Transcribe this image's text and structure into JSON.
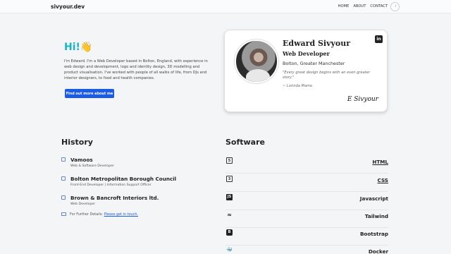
{
  "nav": {
    "brand": "sivyour.dev",
    "links": [
      "HOME",
      "ABOUT",
      "CONTACT"
    ],
    "theme_toggle": "☽"
  },
  "hero": {
    "title": "Hi!",
    "wave": "👋",
    "intro": "I'm Edward. I'm a Web Developer based in Bolton, England, with experience in web design and development, logo and identity design, 3D modelling and product visualisation. I've worked with people of all walks of life, from DJs and interior designers, to food and health companies.",
    "cta_label": "Find out more about me"
  },
  "card": {
    "name": "Edward Sivyour",
    "role": "Web Developer",
    "location": "Bolton, Greater Manchester",
    "quote": "\"Every great design begins with an even greater story.\"",
    "author": "~ Lorinda Mamo",
    "signature": "E Sivyour",
    "linkedin_icon": "in"
  },
  "history": {
    "heading": "History",
    "items": [
      {
        "title": "Vamoos",
        "subtitle": "Web & Software Developer"
      },
      {
        "title": "Bolton Metropolitan Borough Council",
        "subtitle": "Front-End Developer | Information Support Officer"
      },
      {
        "title": "Brown & Bancroft Interiors ltd.",
        "subtitle": "Web Developer"
      }
    ],
    "further_text": "For Further Details: ",
    "further_link": "Please get in touch."
  },
  "software": {
    "heading": "Software",
    "items": [
      {
        "label": "HTML",
        "icon": "5",
        "color": "#333"
      },
      {
        "label": "CSS",
        "icon": "3",
        "color": "#333"
      },
      {
        "label": "Javascript",
        "icon": "JS",
        "color": "#222"
      },
      {
        "label": "Tailwind",
        "icon": "≈",
        "color": "#222"
      },
      {
        "label": "Bootstrap",
        "icon": "B",
        "color": "#222"
      },
      {
        "label": "Docker",
        "icon": "🐳",
        "color": "#222"
      }
    ]
  }
}
